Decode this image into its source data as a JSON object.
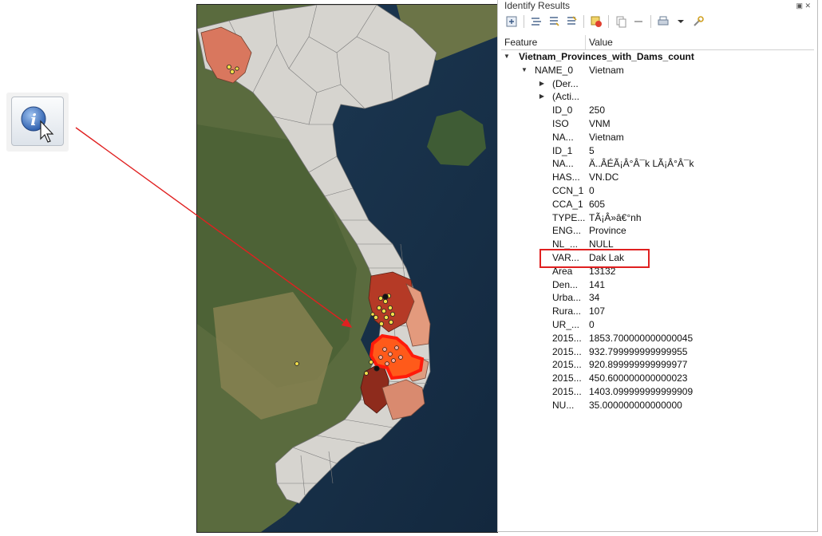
{
  "panel": {
    "title": "Identify Results",
    "controls": "▣ ✕",
    "columns": {
      "feature": "Feature",
      "value": "Value"
    },
    "layer_name": "Vietnam_Provinces_with_Dams_count",
    "name0": {
      "key": "NAME_0",
      "value": "Vietnam"
    },
    "derived_label": "(Der...",
    "actions_label": "(Acti...",
    "attributes": [
      {
        "key": "ID_0",
        "value": "250"
      },
      {
        "key": "ISO",
        "value": "VNM"
      },
      {
        "key": "NA...",
        "value": "Vietnam"
      },
      {
        "key": "ID_1",
        "value": "5"
      },
      {
        "key": "NA...",
        "value": "Ä..ÂÉÃ¡Â°Â¯k LÃ¡Â°Â¯k"
      },
      {
        "key": "HAS...",
        "value": "VN.DC"
      },
      {
        "key": "CCN_1",
        "value": "0"
      },
      {
        "key": "CCA_1",
        "value": "605"
      },
      {
        "key": "TYPE...",
        "value": "TÃ¡Â»â€°nh"
      },
      {
        "key": "ENG...",
        "value": "Province"
      },
      {
        "key": "NL_...",
        "value": "NULL"
      },
      {
        "key": "VAR...",
        "value": "Dak Lak"
      },
      {
        "key": "Area",
        "value": "13132"
      },
      {
        "key": "Den...",
        "value": "141"
      },
      {
        "key": "Urba...",
        "value": "34"
      },
      {
        "key": "Rura...",
        "value": "107"
      },
      {
        "key": "UR_...",
        "value": "0"
      },
      {
        "key": "2015...",
        "value": "1853.700000000000045"
      },
      {
        "key": "2015...",
        "value": "932.799999999999955"
      },
      {
        "key": "2015...",
        "value": "920.899999999999977"
      },
      {
        "key": "2015...",
        "value": "450.600000000000023"
      },
      {
        "key": "2015...",
        "value": "1403.099999999999909"
      },
      {
        "key": "NU...",
        "value": "35.000000000000000"
      }
    ]
  },
  "colors": {
    "highlight_box": "#e02020",
    "selected_province": "#ff2a10",
    "dam_points": "#f4e04a"
  }
}
